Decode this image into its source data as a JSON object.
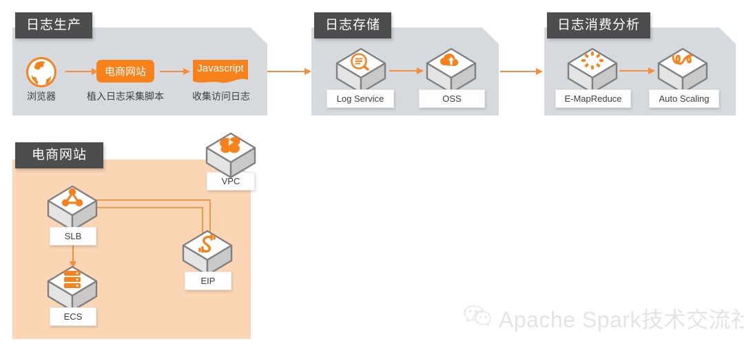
{
  "diagram": {
    "title_bar_color": "#4d4d4d",
    "accent_color": "#f7821b",
    "panel_gray": "#d6dade",
    "panel_orange": "#fbd6b4"
  },
  "panels": [
    {
      "id": "log-production",
      "title": "日志生产",
      "nodes": [
        {
          "name": "browser",
          "icon": "globe-icon",
          "caption": "浏览器"
        },
        {
          "name": "ecommerce-site",
          "label": "电商网站",
          "caption": "植入日志采集脚本"
        },
        {
          "name": "javascript",
          "label": "Javascript",
          "caption": "收集访问日志"
        }
      ]
    },
    {
      "id": "log-storage",
      "title": "日志存储",
      "nodes": [
        {
          "name": "log-service",
          "icon": "log-search-icon",
          "label": "Log Service"
        },
        {
          "name": "oss",
          "icon": "cloud-upload-icon",
          "label": "OSS"
        }
      ]
    },
    {
      "id": "log-analysis",
      "title": "日志消费分析",
      "nodes": [
        {
          "name": "emapreduce",
          "icon": "spinner-dots-icon",
          "label": "E-MapReduce"
        },
        {
          "name": "auto-scaling",
          "icon": "wave-icon",
          "label": "Auto Scaling"
        }
      ]
    },
    {
      "id": "ecommerce-website",
      "title": "电商网站",
      "nodes": [
        {
          "name": "vpc",
          "icon": "vpc-cloud-icon",
          "label": "VPC"
        },
        {
          "name": "slb",
          "icon": "load-balancer-icon",
          "label": "SLB"
        },
        {
          "name": "ecs",
          "icon": "server-stack-icon",
          "label": "ECS"
        },
        {
          "name": "eip",
          "icon": "link-icon",
          "label": "EIP"
        }
      ]
    }
  ],
  "watermark": {
    "icon": "wechat-icon",
    "text": "Apache Spark技术交流社区"
  }
}
